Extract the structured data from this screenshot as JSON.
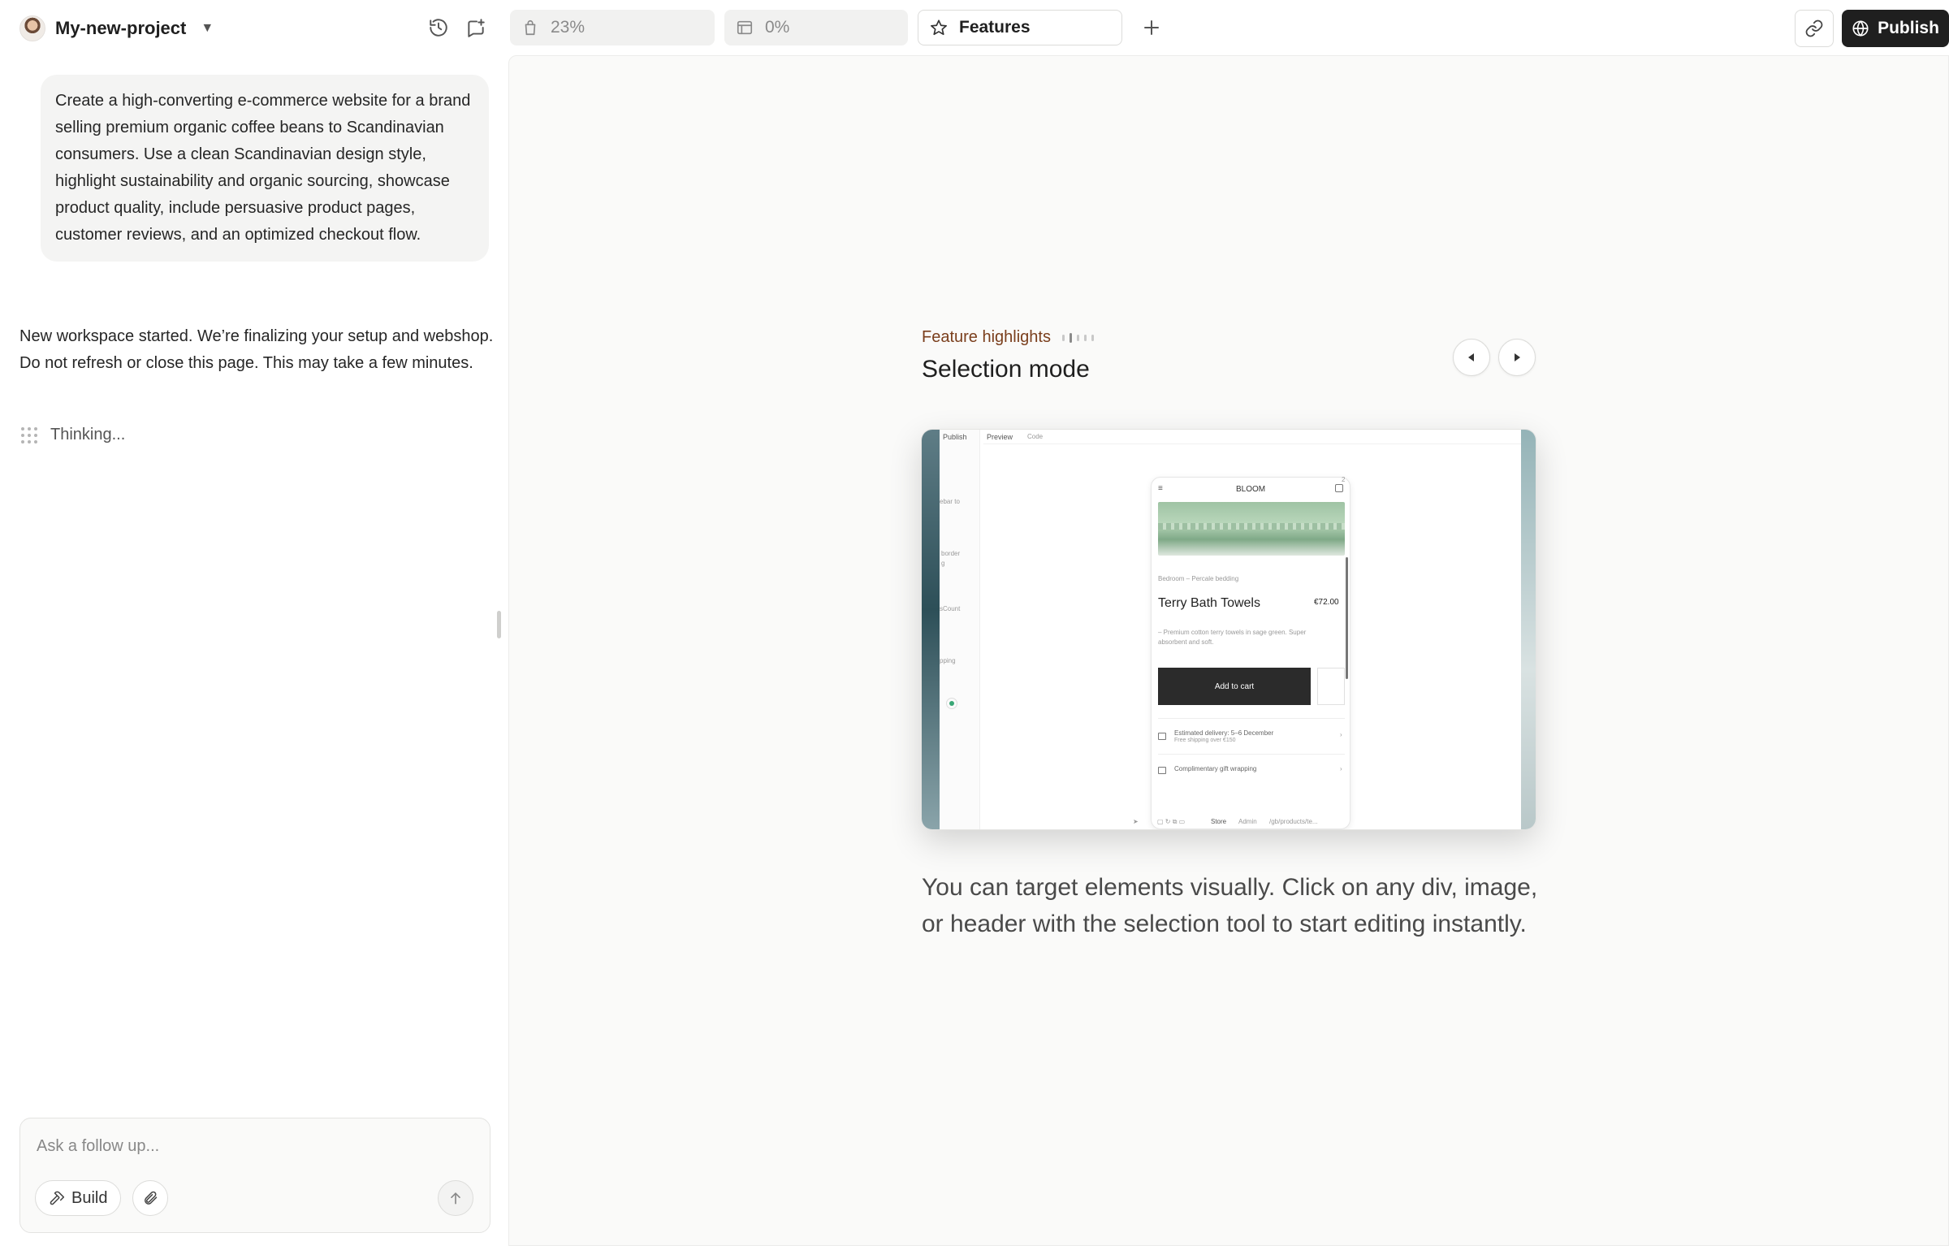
{
  "project": {
    "name": "My-new-project"
  },
  "header": {
    "history_icon": "history-icon",
    "new_chat_icon": "new-chat-icon"
  },
  "chat": {
    "prompt": "Create a high-converting e-commerce website for a brand selling premium organic coffee beans to Scandinavian consumers. Use a clean Scandinavian design style, highlight sustainability and organic sourcing, showcase product quality, include persuasive product pages, customer reviews, and an optimized checkout flow.",
    "status": "New workspace started. We’re finalizing your setup and webshop. Do not refresh or close this page. This may take a few minutes.",
    "thinking": "Thinking..."
  },
  "composer": {
    "placeholder": "Ask a follow up...",
    "build_label": "Build"
  },
  "tabs": [
    {
      "label": "23%",
      "icon": "bag-icon"
    },
    {
      "label": "0%",
      "icon": "browser-icon"
    },
    {
      "label": "Features",
      "icon": "star-icon"
    }
  ],
  "toolbar": {
    "publish_label": "Publish"
  },
  "feature": {
    "label": "Feature highlights",
    "title": "Selection mode",
    "pager_count": 5,
    "pager_active": 1,
    "description": "You can target elements visually. Click on any div, image, or header with the selection tool to start editing instantly."
  },
  "preview": {
    "publish": "Publish",
    "tab_preview": "Preview",
    "tab_code": "Code",
    "side_1": "ebar to",
    "side_2": "border",
    "side_3": "g",
    "side_4": "sCount",
    "side_5": "pping",
    "brand": "BLOOM",
    "cart_count": "2",
    "breadcrumb": "Bedroom – Percale bedding",
    "product_name": "Terry Bath Towels",
    "price": "€72.00",
    "product_desc_1": "– Premium cotton terry towels in sage green. Super",
    "product_desc_2": "absorbent and soft.",
    "add_to_cart": "Add to cart",
    "delivery": "Estimated delivery: 5–6 December",
    "free_shipping": "Free shipping over €150",
    "gift": "Complimentary gift wrapping",
    "bottom_store": "Store",
    "bottom_admin": "Admin",
    "bottom_path": "/gb/products/te..."
  },
  "colors": {
    "accent_label": "#7a3e1c",
    "publish_bg": "#1f1f1f",
    "canvas_bg": "#fafaf9"
  }
}
